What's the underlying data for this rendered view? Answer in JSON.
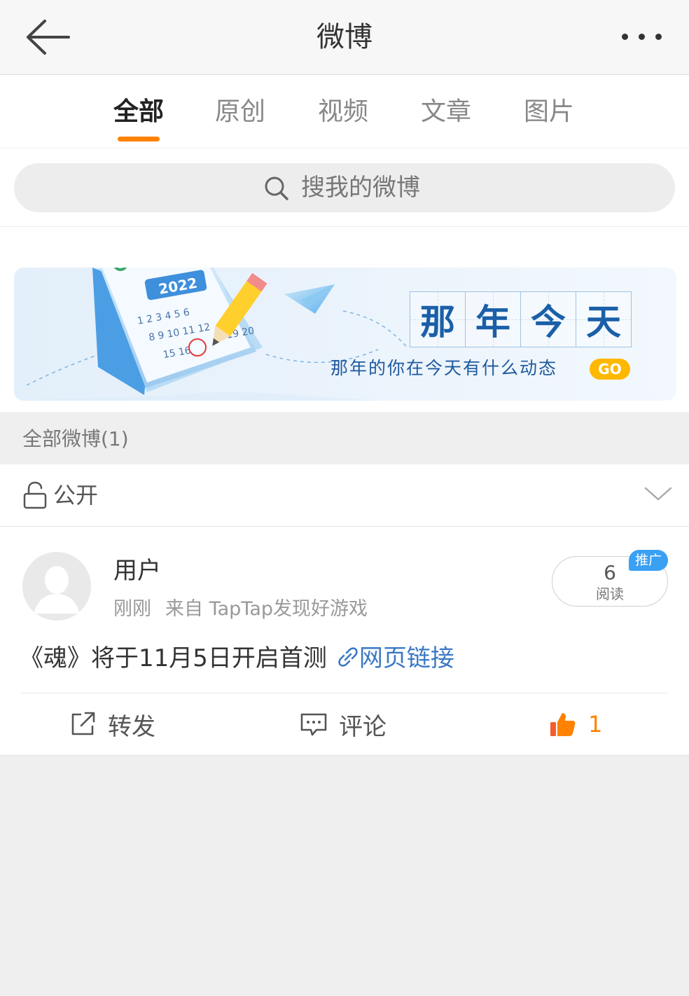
{
  "header": {
    "title": "微博"
  },
  "tabs": [
    {
      "label": "全部",
      "active": true
    },
    {
      "label": "原创",
      "active": false
    },
    {
      "label": "视频",
      "active": false
    },
    {
      "label": "文章",
      "active": false
    },
    {
      "label": "图片",
      "active": false
    }
  ],
  "search": {
    "placeholder": "搜我的微博"
  },
  "banner": {
    "calendar_year": "2022",
    "title_chars": [
      "那",
      "年",
      "今",
      "天"
    ],
    "subtitle": "那年的你在今天有什么动态",
    "go_label": "GO"
  },
  "section": {
    "label": "全部微博(1)"
  },
  "visibility": {
    "label": "公开"
  },
  "post": {
    "username": "用户",
    "time": "刚刚",
    "source": "来自 TapTap发现好游戏",
    "reads_count": "6",
    "reads_label": "阅读",
    "promo_badge": "推广",
    "text": "《魂》将于11月5日开启首测",
    "link_text": "网页链接",
    "actions": {
      "repost": "转发",
      "comment": "评论",
      "like_count": "1"
    }
  },
  "colors": {
    "accent": "#ff8200",
    "link": "#3b79c4",
    "promo": "#3aa0f3"
  }
}
